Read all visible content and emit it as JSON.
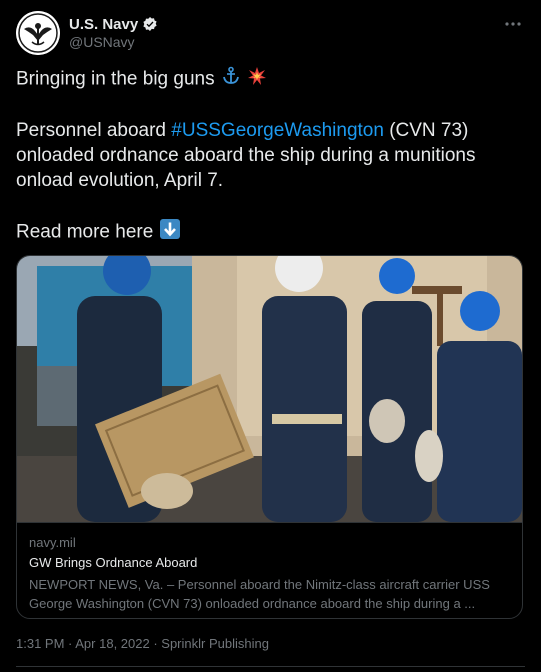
{
  "author": {
    "display_name": "U.S. Navy",
    "handle": "@USNavy",
    "avatar_icon": "navy-seal-icon",
    "verified_icon": "verified-badge-icon",
    "verified_color": "#1d9bf0"
  },
  "tweet": {
    "line1": "Bringing in the big guns",
    "line2_pre": "Personnel aboard ",
    "hashtag": "#USSGeorgeWashington",
    "line2_post": " (CVN 73)",
    "line3": "onloaded ordnance aboard the ship during a munitions",
    "line4": "onload evolution, April 7.",
    "line5": "Read more here",
    "hashtag_color": "#1d9bf0"
  },
  "card": {
    "domain": "navy.mil",
    "title": "GW Brings Ordnance Aboard",
    "desc1": "NEWPORT NEWS, Va. – Personnel aboard the Nimitz-class aircraft carrier USS",
    "desc2": "George Washington (CVN 73) onloaded ordnance aboard the ship during a ..."
  },
  "meta": {
    "time": "1:31 PM",
    "sep1": " · ",
    "date": "Apr 18, 2022",
    "sep2": " · ",
    "source": "Sprinklr Publishing"
  }
}
